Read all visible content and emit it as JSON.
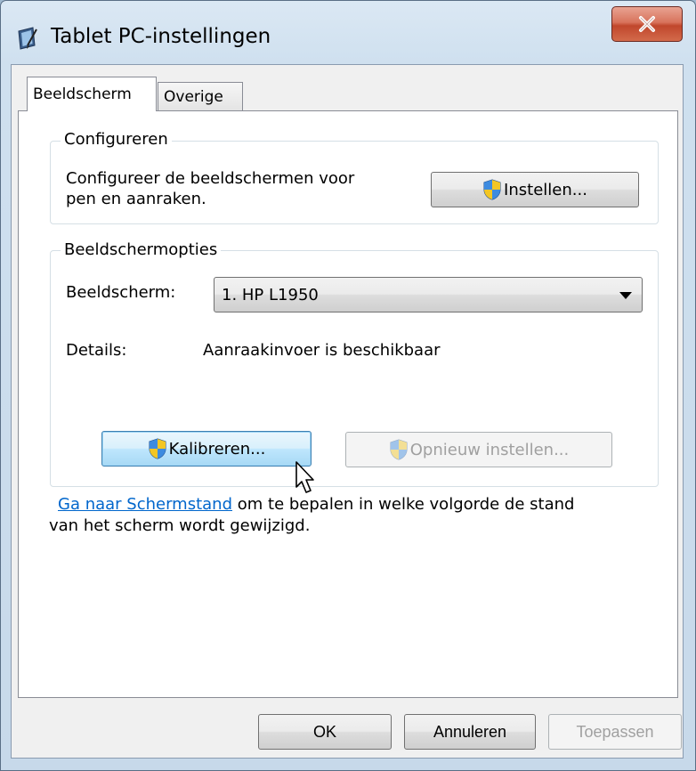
{
  "window": {
    "title": "Tablet PC-instellingen"
  },
  "tabs": [
    {
      "label": "Beeldscherm",
      "active": true
    },
    {
      "label": "Overige",
      "active": false
    }
  ],
  "configure_group": {
    "legend": "Configureren",
    "description_line1": "Configureer de beeldschermen voor",
    "description_line2": "pen en aanraken.",
    "setup_button": "Instellen..."
  },
  "display_group": {
    "legend": "Beeldschermopties",
    "display_label": "Beeldscherm:",
    "display_selected": "1. HP L1950",
    "details_label": "Details:",
    "details_value": "Aanraakinvoer is beschikbaar",
    "calibrate_button": "Kalibreren...",
    "reset_button": "Opnieuw instellen..."
  },
  "orientation_note": {
    "link_text": "Ga naar Schermstand",
    "text_line1_rest": " om te bepalen in welke volgorde de stand",
    "text_line2": "van het scherm wordt gewijzigd."
  },
  "footer": {
    "ok": "OK",
    "cancel": "Annuleren",
    "apply": "Toepassen"
  },
  "icons": {
    "app": "tablet-pc-icon",
    "close": "close-icon",
    "uac": "uac-shield-icon",
    "dropdown": "chevron-down-icon",
    "cursor": "mouse-pointer-icon"
  }
}
